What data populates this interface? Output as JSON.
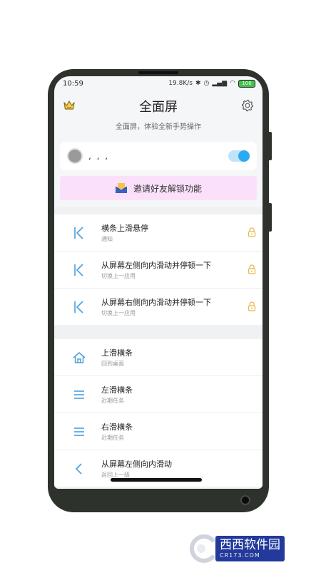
{
  "status_bar": {
    "time": "10:59",
    "network_speed": "19.8K/s",
    "battery": "100"
  },
  "header": {
    "title": "全面屏",
    "subtitle": "全面屏，体验全新手势操作",
    "left_icon": "crown-icon",
    "right_icon": "gear-icon"
  },
  "profile": {
    "name": ", , ,",
    "toggle_on": true
  },
  "invite": {
    "label": "邀请好友解锁功能",
    "icon": "envelope-icon"
  },
  "section1": [
    {
      "icon": "bar-back-icon",
      "title": "横条上滑悬停",
      "sub": "通知",
      "locked": true
    },
    {
      "icon": "bar-back-icon",
      "title": "从屏幕左侧向内滑动并停顿一下",
      "sub": "切换上一应用",
      "locked": true
    },
    {
      "icon": "bar-back-icon",
      "title": "从屏幕右侧向内滑动并停顿一下",
      "sub": "切换上一应用",
      "locked": true
    }
  ],
  "section2": [
    {
      "icon": "home-icon",
      "title": "上滑横条",
      "sub": "回到桌面"
    },
    {
      "icon": "menu-icon",
      "title": "左滑横条",
      "sub": "近期任务"
    },
    {
      "icon": "menu-icon",
      "title": "右滑横条",
      "sub": "近期任务"
    },
    {
      "icon": "chevron-left-icon",
      "title": "从屏幕左侧向内滑动",
      "sub": "返回上一级"
    }
  ],
  "colors": {
    "accent": "#2aaaf0",
    "icon_blue": "#4a9fdc",
    "lock_gold": "#e8b84a",
    "invite_bg": "#fbe0fb",
    "frame": "#2e322d"
  },
  "watermark": {
    "brand": "西西软件园",
    "domain": "CR173.COM"
  }
}
